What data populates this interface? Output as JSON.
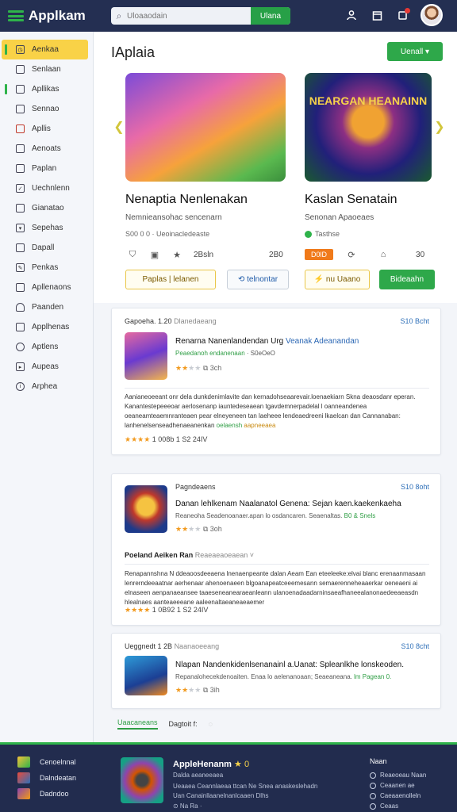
{
  "header": {
    "brand": "Applkam",
    "search_placeholder": "Uloaaodain",
    "search_button": "Ulana"
  },
  "sidebar": {
    "items": [
      {
        "label": "Aenkaa",
        "icon": "clock-icon",
        "active": true
      },
      {
        "label": "Senlaan",
        "icon": "grid-icon"
      },
      {
        "label": "Apllikas",
        "icon": "apps-icon"
      },
      {
        "label": "Sennao",
        "icon": "list-icon"
      },
      {
        "label": "Apllis",
        "icon": "calendar-icon"
      },
      {
        "label": "Aenoats",
        "icon": "chart-icon"
      },
      {
        "label": "Paplan",
        "icon": "doc-icon"
      },
      {
        "label": "Uechnlenn",
        "icon": "check-icon"
      },
      {
        "label": "Gianatao",
        "icon": "box-icon"
      },
      {
        "label": "Sepehas",
        "icon": "down-icon"
      },
      {
        "label": "Dapall",
        "icon": "folder-icon"
      },
      {
        "label": "Penkas",
        "icon": "pencil-icon"
      },
      {
        "label": "Apllenaons",
        "icon": "tag-icon"
      },
      {
        "label": "Paanden",
        "icon": "home-icon"
      },
      {
        "label": "Applhenas",
        "icon": "file-icon"
      },
      {
        "label": "Aptlens",
        "icon": "settings-icon"
      },
      {
        "label": "Aupeas",
        "icon": "play-icon"
      },
      {
        "label": "Arphea",
        "icon": "info-icon"
      }
    ]
  },
  "main": {
    "title": "IAplaia",
    "top_action": "Uenall ▾",
    "featured": [
      {
        "title": "Nenaptia Nenlenakan",
        "subtitle": "Nemnieansohac sencenarn",
        "meta": "S00 0 0 · Ueoinacledeaste",
        "stats": [
          "2Bsln",
          "2B0"
        ],
        "button_primary": "Paplas | lelanen",
        "button_secondary": "⟲ telnontar"
      },
      {
        "title": "Kaslan Senatain",
        "subtitle": "Senonan Apaoeaes",
        "meta": "Tasthse",
        "badge": "D0lD",
        "stats": [
          "30"
        ],
        "button_primary": "⚡ nu Uaano",
        "button_secondary": "Bideaahn",
        "image_text": "NEARGAN HEANAINN"
      }
    ],
    "cards": [
      {
        "head": "Gapoeha. 1.20",
        "head_muted": "Dlanedaeang",
        "price": "S10 Bcht",
        "title": "Renarna Nanenlandendan Urg",
        "title_link": "Veanak Adeanandan",
        "line": "Peaedanoh endanenaan",
        "line_muted": "· S0eOeO",
        "rating": "3ch",
        "desc": "Aanianeoeeant onr dela dunkdenimlavite dan kernadohseaarevair.loenaekiarn Skna deaosdanr eperan. Kanantestepeeeoar aerlosenanp iauntedeseaean tgavdemnerpadelal l oanneandenea oeaneamteaemnranteaen pear elneyeneen tan laeheee lendeaedreeni lkaelcan dan Cannanaban: lanhenelsenseadhenaeanenkan",
        "desc_green": "oelaensh",
        "desc_orange": "aapneeaea",
        "foot": "1 008b 1 S2 24IV"
      },
      {
        "head": "Pagndeaens",
        "price": "S10 8oht",
        "title": "Danan lehlkenam Naalanatol Genena: Sejan kaen.kaekenkaeha",
        "line": "Reaneoha Seadenoanaer.apan lo osdancaren. Seaenaltas.",
        "line_green": "B0 & Snels",
        "rating": "3oh",
        "subhead": "Poeland Aeiken Ran",
        "subhead_muted": "Reaeaeaoeaean ˅",
        "desc": "Renapannshna N ddeaoosdeeaena lnenaenpeante dalan Aeam Ean eteeleeke:elvai blanc erenaanmasaan lenrerndeeaatnar aerhenaar ahenoenaeen blgoanapeatceeemesann semaerenneheaaerkar oeneaeni ai elnaseen aenpanaeansee taaeseneanearaeanleann ulanoenadaadarninsaeafhaneealanonaedeeaeasdn hlealnaes aanteaeeeane aaleenaltaeaneaeaemer",
        "foot": "1 0B92 1 S2 24IV"
      },
      {
        "head": "Ueggnedt 1 2B",
        "head_muted": "Naanaoeeang",
        "price": "S10 8cht",
        "title": "Nlapan Nandenkidenlsenanainl a.Uanat: Spleanlkhe lonskeoden.",
        "line": "Repanalohecekdenoaiten. Enaa lo aelenanoaan; Seaeaneana.",
        "line_green": "lm Pagean 0.",
        "rating": "3ih"
      }
    ],
    "tabs": [
      "Uaacaneans",
      "Dagtoit f:"
    ]
  },
  "footer": {
    "list": [
      "Cenoelnnal",
      "Dalndeatan",
      "Dadndoo"
    ],
    "title": "AppleHenanm",
    "title_badge": "★ 0",
    "sub1": "Dalda aeaneeaea",
    "sub2": "Ueaaea Ceannlaeaa ttcan Ne Snea anaskeslehadn",
    "sub3": "Uan Canainllaanelnanlcaaen Dlhs",
    "sub4": "⊙ Na Ra ·",
    "right_title": "Naan",
    "right_links": [
      "Reaeoeau Naan",
      "Ceaanen ae",
      "Caeaaenolleln",
      "Ceaas"
    ]
  },
  "colors": {
    "topbar": "#242f52",
    "accent_green": "#2fb34a",
    "active_yellow": "#f9d247",
    "link_blue": "#2b67b4",
    "star_orange": "#f29a1e",
    "footer": "#222c4e"
  }
}
